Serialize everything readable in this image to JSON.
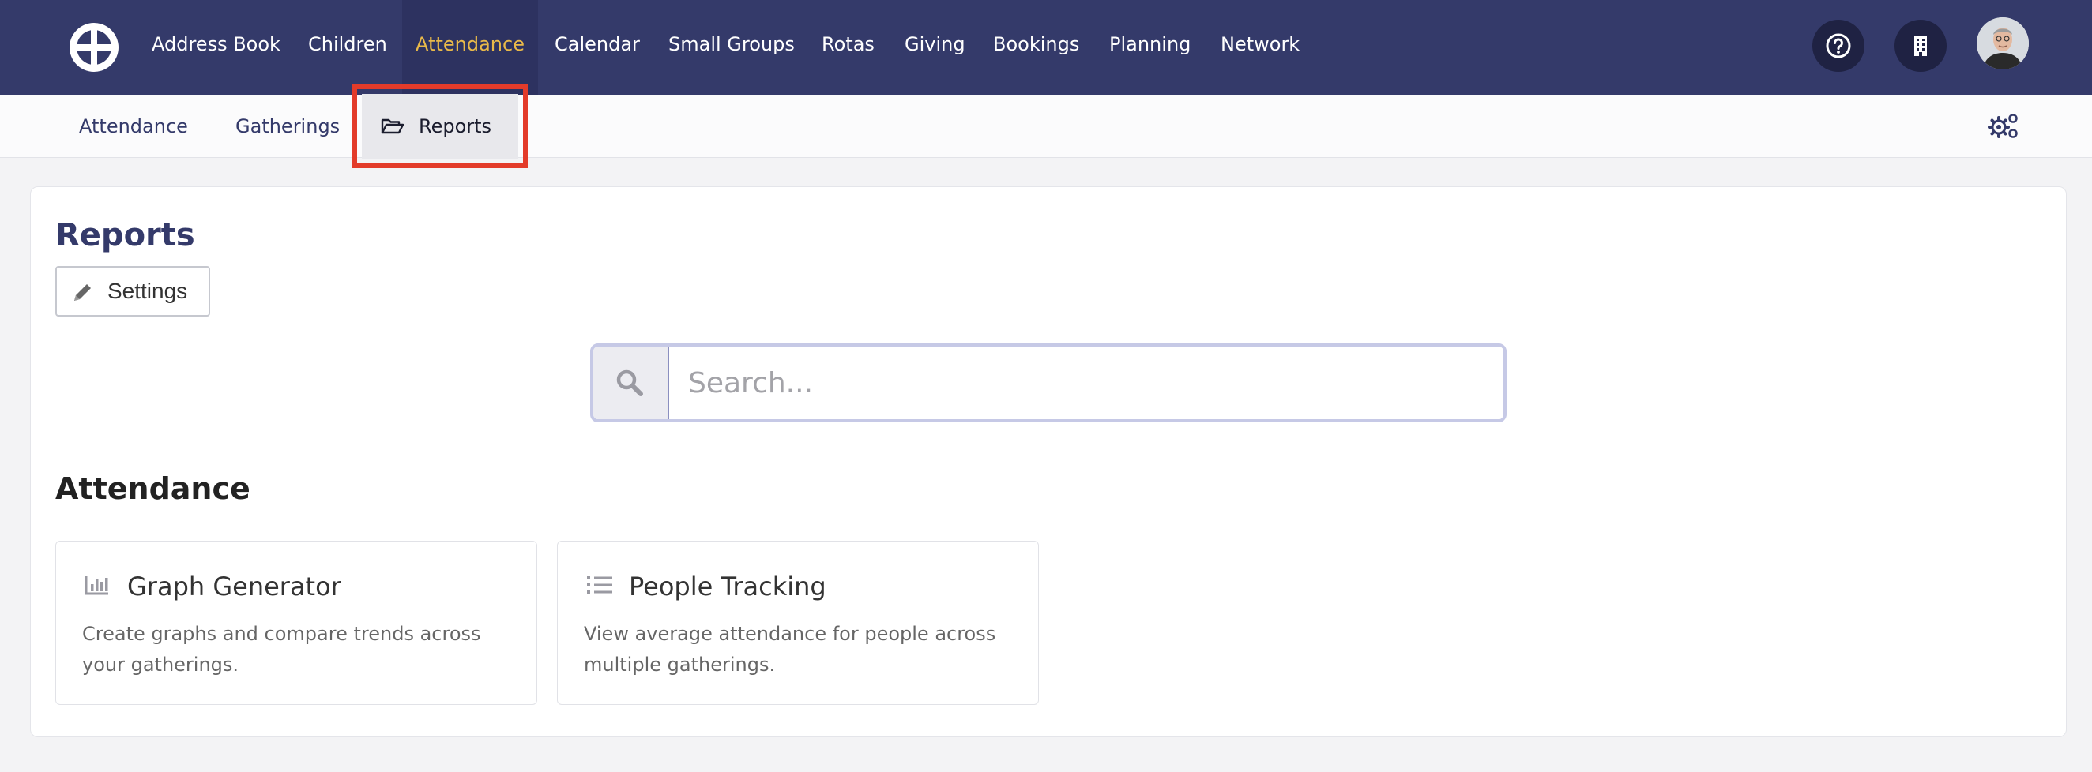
{
  "nav": {
    "items": [
      {
        "label": "Address Book"
      },
      {
        "label": "Children"
      },
      {
        "label": "Attendance",
        "active": true
      },
      {
        "label": "Calendar"
      },
      {
        "label": "Small Groups"
      },
      {
        "label": "Rotas"
      },
      {
        "label": "Giving"
      },
      {
        "label": "Bookings"
      },
      {
        "label": "Planning"
      },
      {
        "label": "Network"
      }
    ],
    "icons": [
      "help-icon",
      "building-icon"
    ],
    "colors": {
      "bar": "#343a6a",
      "active_text": "#e9b949"
    }
  },
  "subnav": {
    "items": [
      {
        "label": "Attendance"
      },
      {
        "label": "Gatherings"
      },
      {
        "label": "Reports",
        "active": true,
        "icon": "folder-open-icon"
      }
    ],
    "settings_icon": "gears-icon"
  },
  "page": {
    "title": "Reports",
    "settings_label": "Settings"
  },
  "search": {
    "placeholder": "Search..."
  },
  "section": {
    "title": "Attendance",
    "cards": [
      {
        "title": "Graph Generator",
        "description": "Create graphs and compare trends across your gatherings.",
        "icon": "bar-chart-icon"
      },
      {
        "title": "People Tracking",
        "description": "View average attendance for people across multiple gatherings.",
        "icon": "list-icon"
      }
    ]
  },
  "highlight_color": "#e33b2a"
}
